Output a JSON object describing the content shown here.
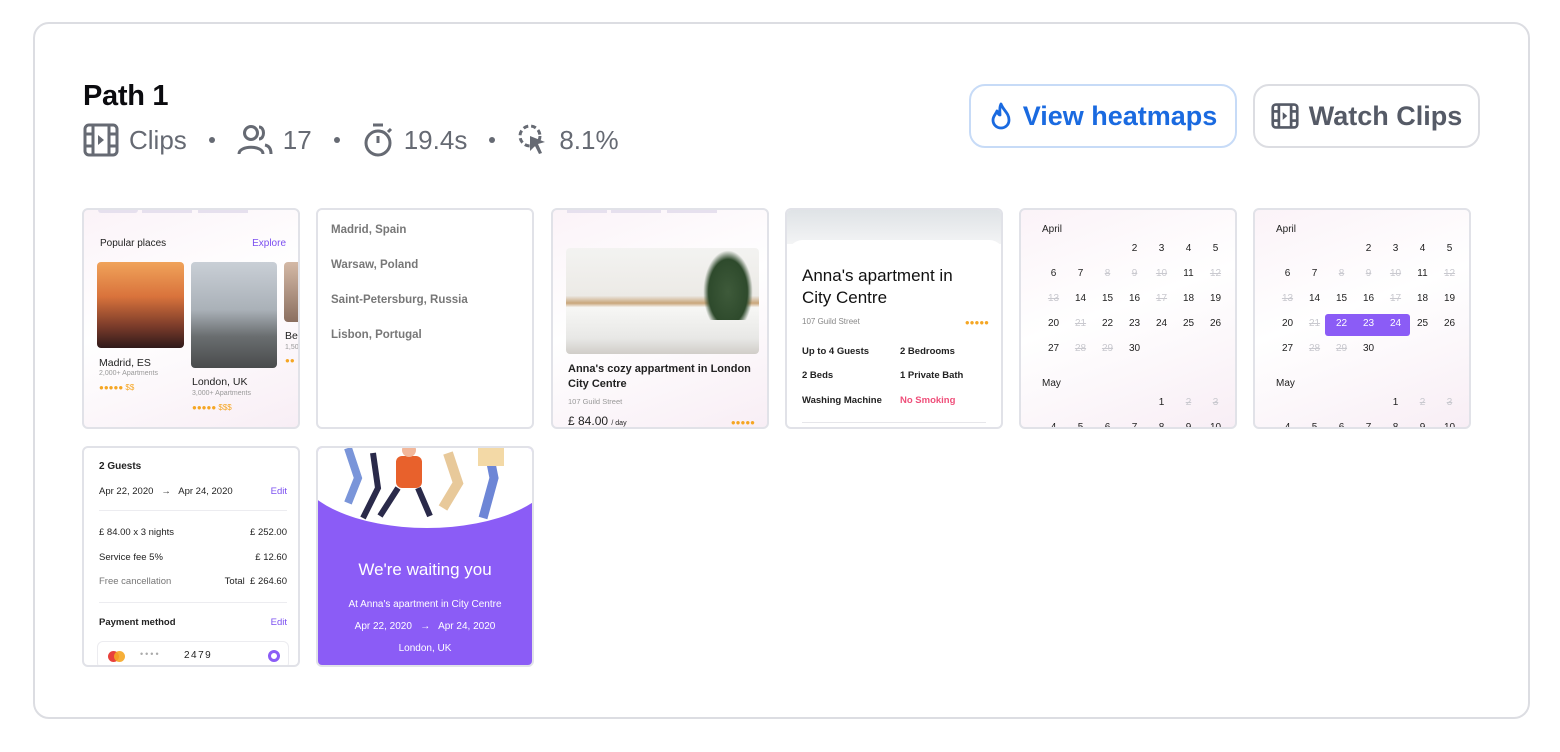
{
  "header": {
    "title": "Path 1",
    "clips_label": "Clips",
    "users_count": "17",
    "duration": "19.4s",
    "rate": "8.1%"
  },
  "buttons": {
    "heatmaps": "View heatmaps",
    "clips": "Watch Clips"
  },
  "colors": {
    "accent_blue": "#1a6ae0",
    "brand_purple": "#8b5cf6"
  },
  "thumbs": {
    "popular": {
      "title": "Popular places",
      "explore": "Explore",
      "places": [
        {
          "name": "Madrid, ES",
          "sub": "2,000+ Apartments",
          "stars": "●●●●● $$"
        },
        {
          "name": "London, UK",
          "sub": "3,000+ Apartments",
          "stars": "●●●●● $$$"
        },
        {
          "name": "Ber",
          "sub": "1,50",
          "stars": "●●"
        }
      ]
    },
    "cities": [
      "Madrid, Spain",
      "Warsaw, Poland",
      "Saint-Petersburg, Russia",
      "Lisbon, Portugal"
    ],
    "listing": {
      "title": "Anna's cozy appartment in London City Centre",
      "address": "107  Guild Street",
      "price": "£ 84.00",
      "per": "/ day",
      "stars": "●●●●●"
    },
    "apartment": {
      "title": "Anna's apartment in City Centre",
      "address": "107  Guild Street",
      "stars": "●●●●●",
      "features": [
        "Up to 4 Guests",
        "2 Bedrooms",
        "2 Beds",
        "1 Private Bath",
        "Washing Machine",
        "No Smoking"
      ]
    },
    "calendar": {
      "month1": "April",
      "month2": "May",
      "rows": [
        [
          "",
          "",
          "",
          "2",
          "3",
          "4",
          "5"
        ],
        [
          "6",
          "7",
          "8",
          "9",
          "10",
          "11",
          "12"
        ],
        [
          "13",
          "14",
          "15",
          "16",
          "17",
          "18",
          "19"
        ],
        [
          "20",
          "21",
          "22",
          "23",
          "24",
          "25",
          "26"
        ],
        [
          "27",
          "28",
          "29",
          "30",
          "",
          "",
          ""
        ]
      ],
      "may_rows": [
        [
          "",
          "",
          "",
          "",
          "1",
          "2",
          "3"
        ],
        [
          "4",
          "5",
          "6",
          "7",
          "8",
          "9",
          "10"
        ]
      ]
    },
    "booking": {
      "guests": "2 Guests",
      "from": "Apr 22, 2020",
      "arrow": "→",
      "to": "Apr 24, 2020",
      "edit": "Edit",
      "line1_label": "£ 84.00 x 3 nights",
      "line1_value": "£ 252.00",
      "line2_label": "Service fee 5%",
      "line2_value": "£ 12.60",
      "line3_label": "Free cancellation",
      "total_label": "Total",
      "total_value": "£ 264.60",
      "payment_label": "Payment method",
      "payment_edit": "Edit",
      "card_mask": "••••",
      "card_last": "2479"
    },
    "waiting": {
      "title": "We're waiting you",
      "subtitle": "At Anna's apartment in City Centre",
      "from": "Apr 22, 2020",
      "arrow": "→",
      "to": "Apr 24, 2020",
      "city": "London, UK"
    }
  }
}
